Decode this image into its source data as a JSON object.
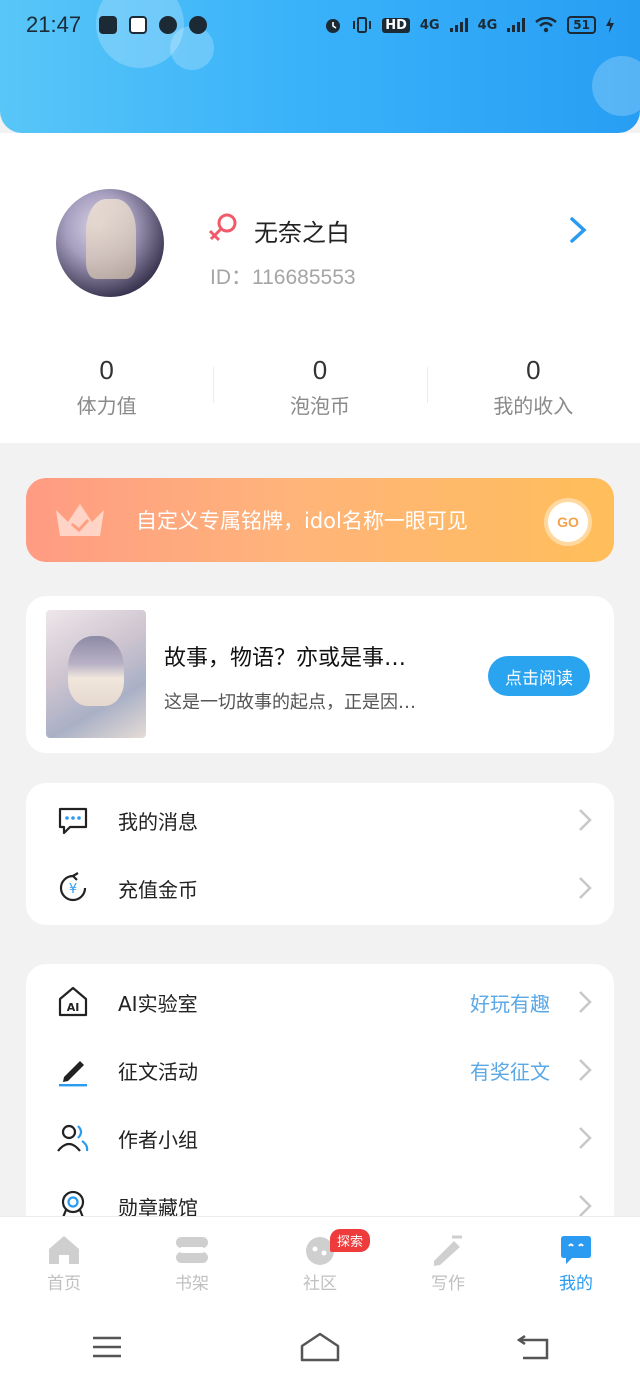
{
  "status_bar": {
    "time": "21:47",
    "network": "4G",
    "network2": "4G",
    "hd": "HD",
    "battery": "51"
  },
  "profile": {
    "username": "无奈之白",
    "user_id": "ID：116685553",
    "stats": [
      {
        "value": "0",
        "label": "体力值"
      },
      {
        "value": "0",
        "label": "泡泡币"
      },
      {
        "value": "0",
        "label": "我的收入"
      }
    ]
  },
  "banner": {
    "text": "自定义专属铭牌，idol名称一眼可见",
    "go_label": "GO"
  },
  "book": {
    "title": "故事，物语？亦或是事…",
    "description": "这是一切故事的起点，正是因…",
    "read_label": "点击阅读"
  },
  "menu_group_1": [
    {
      "label": "我的消息",
      "icon": "message-icon"
    },
    {
      "label": "充值金币",
      "icon": "recharge-icon"
    }
  ],
  "menu_group_2": [
    {
      "label": "AI实验室",
      "extra": "好玩有趣",
      "icon": "ai-lab-icon"
    },
    {
      "label": "征文活动",
      "extra": "有奖征文",
      "icon": "pen-icon"
    },
    {
      "label": "作者小组",
      "extra": "",
      "icon": "group-icon"
    },
    {
      "label": "勋章藏馆",
      "extra": "",
      "icon": "medal-icon"
    }
  ],
  "tabs": [
    {
      "label": "首页",
      "icon": "home-icon"
    },
    {
      "label": "书架",
      "icon": "bookshelf-icon"
    },
    {
      "label": "社区",
      "icon": "community-icon",
      "badge": "探索"
    },
    {
      "label": "写作",
      "icon": "write-icon"
    },
    {
      "label": "我的",
      "icon": "mine-icon",
      "active": true
    }
  ],
  "colors": {
    "accent": "#2a9bf0",
    "header_start": "#58c6f7",
    "header_end": "#279ef3",
    "banner_start": "#ff9b83",
    "banner_end": "#ffbe5a",
    "badge": "#ee3b3b"
  }
}
